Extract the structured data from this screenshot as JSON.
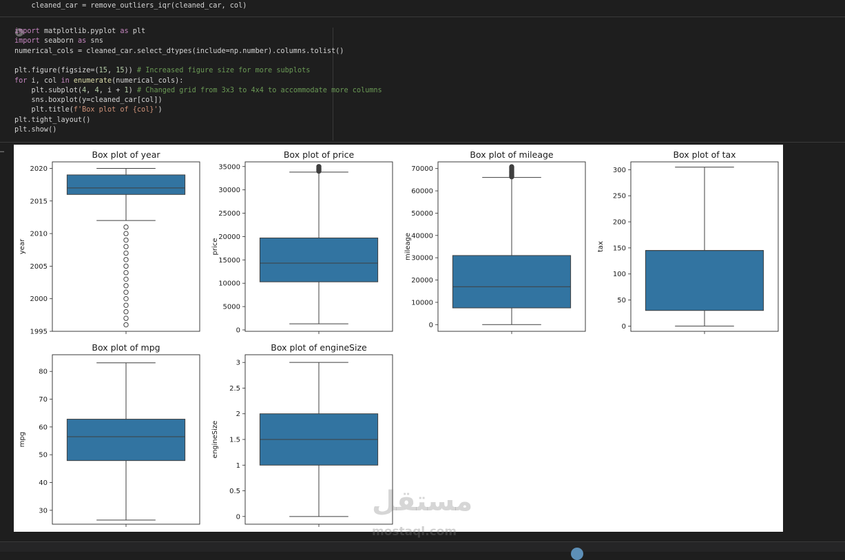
{
  "top_line": "    cleaned_car = remove_outliers_iqr(cleaned_car, col)",
  "code_lines": [
    [
      {
        "t": "import",
        "c": "kw"
      },
      {
        "t": " matplotlib.pyplot "
      },
      {
        "t": "as",
        "c": "kw"
      },
      {
        "t": " plt"
      }
    ],
    [
      {
        "t": "import",
        "c": "kw"
      },
      {
        "t": " seaborn "
      },
      {
        "t": "as",
        "c": "kw"
      },
      {
        "t": " sns"
      }
    ],
    [
      {
        "t": "numerical_cols = cleaned_car.select_dtypes(include=np.number).columns.tolist()"
      }
    ],
    [
      {
        "t": ""
      }
    ],
    [
      {
        "t": "plt.figure(figsize=("
      },
      {
        "t": "15",
        "c": "nm"
      },
      {
        "t": ", "
      },
      {
        "t": "15",
        "c": "nm"
      },
      {
        "t": ")) "
      },
      {
        "t": "# Increased figure size for more subplots",
        "c": "cm"
      }
    ],
    [
      {
        "t": "for",
        "c": "kw"
      },
      {
        "t": " i, col "
      },
      {
        "t": "in",
        "c": "kw"
      },
      {
        "t": " "
      },
      {
        "t": "enumerate",
        "c": "fn"
      },
      {
        "t": "(numerical_cols):"
      }
    ],
    [
      {
        "t": "    plt.subplot("
      },
      {
        "t": "4",
        "c": "nm"
      },
      {
        "t": ", "
      },
      {
        "t": "4",
        "c": "nm"
      },
      {
        "t": ", i + "
      },
      {
        "t": "1",
        "c": "nm"
      },
      {
        "t": ") "
      },
      {
        "t": "# Changed grid from 3x3 to 4x4 to accommodate more columns",
        "c": "cm"
      }
    ],
    [
      {
        "t": "    sns.boxplot(y=cleaned_car[col])"
      }
    ],
    [
      {
        "t": "    plt.title("
      },
      {
        "t": "f'Box plot of {col}'",
        "c": "st"
      },
      {
        "t": ")"
      }
    ],
    [
      {
        "t": "plt.tight_layout()"
      }
    ],
    [
      {
        "t": "plt.show()"
      }
    ]
  ],
  "output_marker": "…",
  "watermark": {
    "arabic": "مستقل",
    "latin": "mostaql.com"
  },
  "colors": {
    "box": "#3274a1",
    "background": "#1e1e1e",
    "plot_bg": "#ffffff"
  },
  "chart_data": [
    {
      "type": "boxplot",
      "title": "Box plot of year",
      "ylabel": "year",
      "ylim": [
        1995,
        2021
      ],
      "yticks": [
        1995,
        2000,
        2005,
        2010,
        2015,
        2020
      ],
      "min": 2012,
      "q1": 2016,
      "median": 2017,
      "q3": 2019,
      "max": 2020,
      "outliers": [
        1996,
        1997,
        1998,
        1999,
        2000,
        2001,
        2002,
        2003,
        2004,
        2005,
        2006,
        2007,
        2008,
        2009,
        2010,
        2011
      ]
    },
    {
      "type": "boxplot",
      "title": "Box plot of price",
      "ylabel": "price",
      "ylim": [
        -300,
        36000
      ],
      "yticks": [
        0,
        5000,
        10000,
        15000,
        20000,
        25000,
        30000,
        35000
      ],
      "min": 1300,
      "q1": 10300,
      "median": 14300,
      "q3": 19700,
      "max": 33800,
      "outliers": [
        34000,
        34200,
        34400,
        34600,
        34800,
        35000
      ]
    },
    {
      "type": "boxplot",
      "title": "Box plot of mileage",
      "ylabel": "mileage",
      "ylim": [
        -3000,
        73000
      ],
      "yticks": [
        0,
        10000,
        20000,
        30000,
        40000,
        50000,
        60000,
        70000
      ],
      "min": 1,
      "q1": 7500,
      "median": 17000,
      "q3": 31000,
      "max": 66000,
      "outliers": [
        66300,
        66800,
        67300,
        67800,
        68300,
        68800,
        69300,
        69800,
        70300,
        70800
      ]
    },
    {
      "type": "boxplot",
      "title": "Box plot of tax",
      "ylabel": "tax",
      "ylim": [
        -10,
        315
      ],
      "yticks": [
        0,
        50,
        100,
        150,
        200,
        250,
        300
      ],
      "min": 0,
      "q1": 30,
      "median": 145,
      "q3": 145,
      "max": 305,
      "outliers": []
    },
    {
      "type": "boxplot",
      "title": "Box plot of mpg",
      "ylabel": "mpg",
      "ylim": [
        25,
        86
      ],
      "yticks": [
        30,
        40,
        50,
        60,
        70,
        80
      ],
      "min": 26.5,
      "q1": 47.9,
      "median": 56.5,
      "q3": 62.8,
      "max": 83.1,
      "outliers": []
    },
    {
      "type": "boxplot",
      "title": "Box plot of engineSize",
      "ylabel": "engineSize",
      "ylim": [
        -0.15,
        3.15
      ],
      "yticks": [
        0.0,
        0.5,
        1.0,
        1.5,
        2.0,
        2.5,
        3.0
      ],
      "min": 0.0,
      "q1": 1.0,
      "median": 1.5,
      "q3": 2.0,
      "max": 3.0,
      "outliers": []
    }
  ]
}
